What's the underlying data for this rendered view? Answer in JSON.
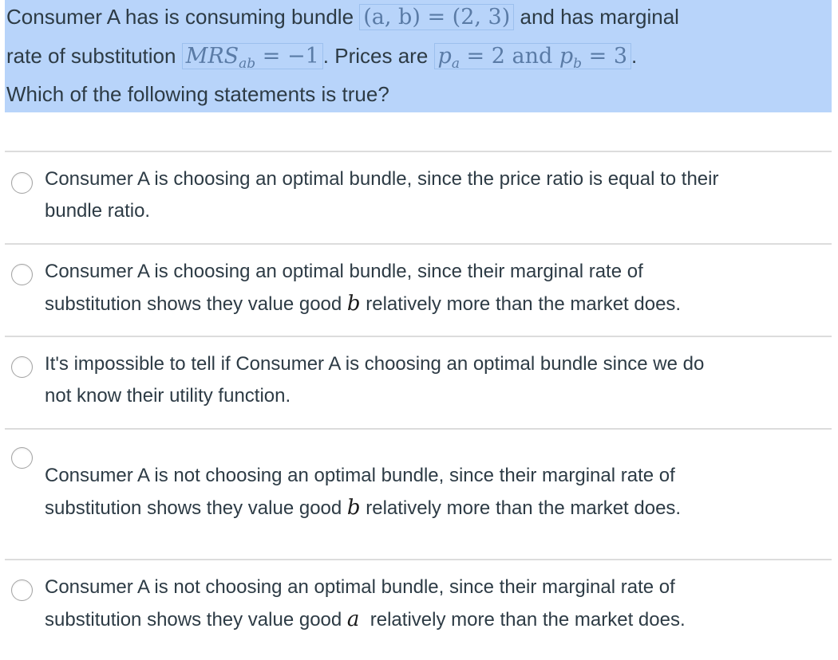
{
  "question": {
    "line1_text_a": "Consumer A has is consuming bundle ",
    "line1_math": "(a, b) = (2, 3)",
    "line1_text_b": "  and has marginal",
    "line2_text_a": "rate of substitution ",
    "line2_math_main": "MRS",
    "line2_math_sub": "ab",
    "line2_math_rest": " = −1",
    "line2_text_b": ".  Prices are ",
    "line2_math2_pa": "p",
    "line2_math2_pa_sub": "a",
    "line2_math2_mid": " = 2 and ",
    "line2_math2_pb": "p",
    "line2_math2_pb_sub": "b",
    "line2_math2_end": " = 3",
    "line2_text_c": ".",
    "line3_text": "Which of the following statements is true?"
  },
  "options": [
    {
      "line1": "Consumer A is choosing an optimal bundle, since the price ratio is equal to their",
      "line2": "bundle ratio.",
      "selected": false
    },
    {
      "line1": "Consumer A is choosing an optimal bundle, since their marginal rate of",
      "line2_a": "substitution shows they value good ",
      "var": "b",
      "line2_b": " relatively more than the market does.",
      "selected": false
    },
    {
      "line1": "It's impossible to tell if Consumer A is choosing an optimal bundle since we do",
      "line2": "not know their utility function.",
      "selected": false
    },
    {
      "line1": "Consumer A is not choosing an optimal bundle, since their marginal rate of",
      "line2_a": "substitution shows they value good ",
      "var": "b",
      "line2_b": " relatively more than the market does.",
      "selected": false
    },
    {
      "line1": "Consumer A is not choosing an optimal bundle, since their marginal rate of",
      "line2_a": "substitution shows they value good ",
      "var": "a",
      "line2_b": "  relatively more than the market does.",
      "selected": false
    }
  ],
  "colors": {
    "highlight": "#b8d4fa",
    "text": "#2d3b45",
    "math": "#5a7ba6",
    "divider": "#dcdcdc"
  }
}
